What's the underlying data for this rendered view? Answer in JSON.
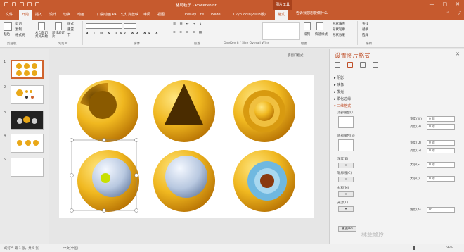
{
  "titlebar": {
    "title": "格局粒子 - PowerPoint",
    "context_tab": "图片工具",
    "minimize": "—",
    "maximize": "□",
    "close": "✕"
  },
  "tabs": [
    "文件",
    "开始",
    "插入",
    "设计",
    "切换",
    "动画",
    "口袋动画 PA",
    "幻灯片放映",
    "审阅",
    "视图",
    "OneKey Lite",
    "iSlide",
    "LvyhTools(2008版)",
    "格式"
  ],
  "tellme": "告诉我您想要做什么",
  "ribbon": {
    "paste": "粘贴",
    "cut": "剪切",
    "copy": "复制",
    "format_painter": "格式刷",
    "from_start": "从当前幻灯片开始",
    "new_slide": "新建幻灯片",
    "layout": "版式",
    "reset": "重置",
    "section": "节",
    "arrange": "排列",
    "quick_styles": "快速样式",
    "shape_fill": "形状填充",
    "shape_outline": "形状轮廓",
    "shape_effects": "形状效果",
    "find": "查找",
    "replace": "替换",
    "select": "选择",
    "group_clipboard": "剪贴板",
    "group_slides": "幻灯片",
    "group_font": "字体",
    "group_paragraph": "段落",
    "group_drawing": "绘图",
    "group_editing": "编辑",
    "group_special": "OneKey 8 / Size Overall Wins"
  },
  "thumbnails": [
    "1",
    "2",
    "3",
    "4",
    "5"
  ],
  "multi_window": "多窗口模式",
  "pane": {
    "title": "设置图片格式",
    "sections": {
      "shadow": "阴影",
      "reflection": "映像",
      "glow": "发光",
      "soft_edges": "柔化边缘",
      "three_d_format": "三维格式"
    },
    "top_bevel": "顶部棱台(T)",
    "bottom_bevel": "底部棱台(B)",
    "depth": "深度(E)",
    "contour": "轮廓线(C)",
    "material": "材料(M)",
    "lighting": "光源(L)",
    "reset": "重置(R)",
    "width1": "宽度(W)",
    "height1": "高度(H)",
    "width2": "宽度(D)",
    "height2": "高度(G)",
    "size1": "大小(S)",
    "size2": "大小(I)",
    "angle": "角度(A)",
    "val_w1": "0 磅",
    "val_h1": "0 磅",
    "val_w2": "0 磅",
    "val_h2": "0 磅",
    "val_s1": "0 磅",
    "val_s2": "0 磅",
    "val_angle": "0°"
  },
  "status": {
    "slide": "幻灯片 第 1 张，共 5 张",
    "lang": "中文(中国)",
    "zoom": "66%"
  },
  "watermark": "林菲帧玲",
  "colors": {
    "accent": "#c65a2e",
    "gold": "#e9a818",
    "core": "#b8c8e0"
  }
}
